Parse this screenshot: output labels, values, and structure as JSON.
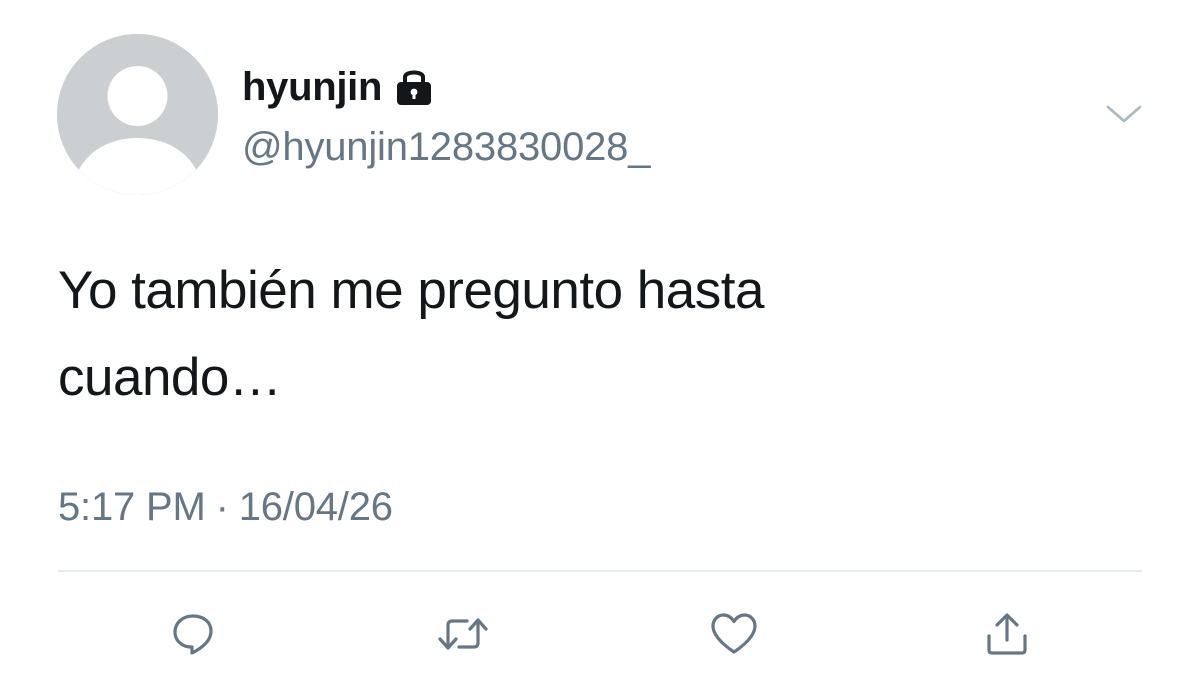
{
  "user": {
    "display_name": "hyunjin",
    "handle": "@hyunjin1283830028_",
    "protected_icon": "lock-icon",
    "avatar_icon": "default-avatar-icon"
  },
  "tweet": {
    "text": "Yo también me pregunto hasta\ncuando…",
    "time": "5:17 PM",
    "separator": "·",
    "date": "16/04/26"
  },
  "actions": {
    "reply_icon": "reply-icon",
    "retweet_icon": "retweet-icon",
    "like_icon": "heart-icon",
    "share_icon": "share-icon",
    "menu_icon": "chevron-down-icon"
  },
  "colors": {
    "text_primary": "#14171a",
    "text_secondary": "#657786",
    "icon_gray": "#657786",
    "avatar_bg": "#cccfd2",
    "divider": "#e6ecf0"
  }
}
